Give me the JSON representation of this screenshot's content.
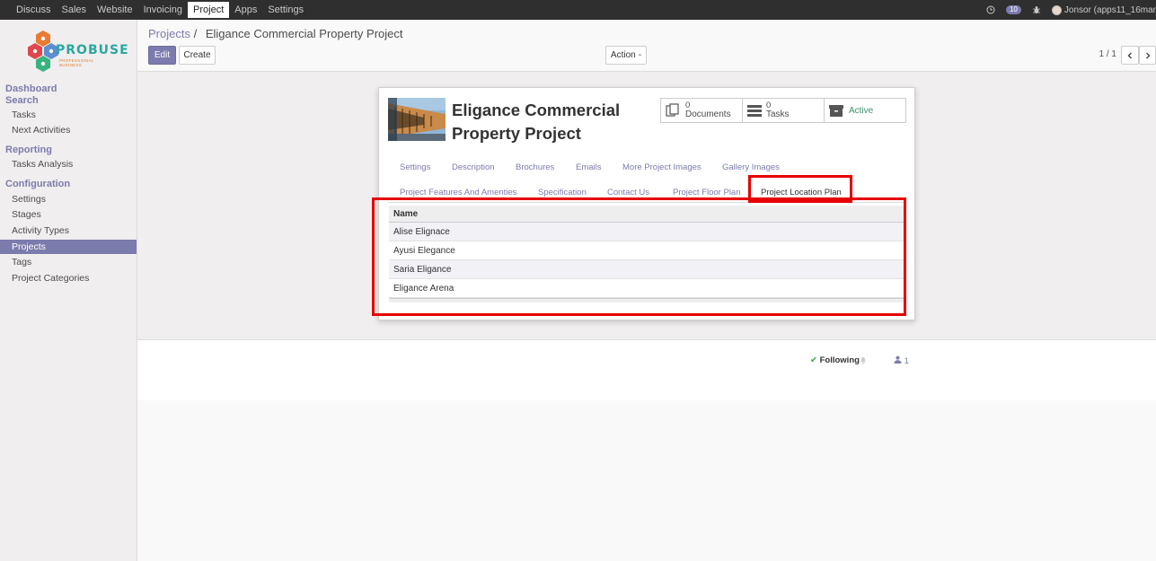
{
  "topnav": {
    "menu": [
      "Discuss",
      "Sales",
      "Website",
      "Invoicing",
      "Project",
      "Apps",
      "Settings"
    ],
    "active": "Project",
    "badge_count": "10",
    "user": "Jonsor (apps11_16mar"
  },
  "logo": {
    "name": "PROBUSE",
    "tagline": "PROFESSIONAL BUSINESS"
  },
  "sidebar": {
    "dashboard": "Dashboard",
    "search": "Search",
    "tasks": "Tasks",
    "next_activities": "Next Activities",
    "reporting": "Reporting",
    "tasks_analysis": "Tasks Analysis",
    "configuration": "Configuration",
    "settings": "Settings",
    "stages": "Stages",
    "activity_types": "Activity Types",
    "projects": "Projects",
    "tags": "Tags",
    "project_categories": "Project Categories"
  },
  "breadcrumb": {
    "parent": "Projects",
    "sep": "/",
    "current": "Eligance Commercial Property Project"
  },
  "buttons": {
    "edit": "Edit",
    "create": "Create",
    "action": "Action"
  },
  "pager": {
    "value": "1 / 1"
  },
  "record": {
    "title_line1": "Eligance Commercial",
    "title_line2": "Property Project",
    "stats": {
      "documents_count": "0",
      "documents_label": "Documents",
      "tasks_count": "0",
      "tasks_label": "Tasks",
      "active_label": "Active"
    }
  },
  "tabs": {
    "row1": [
      "Settings",
      "Description",
      "Brochures",
      "Emails",
      "More Project Images",
      "Gallery Images"
    ],
    "row2": [
      "Project Features And Amenties",
      "Specification",
      "Contact Us",
      "Project Floor Plan",
      "Project Location Plan"
    ],
    "active": "Project Location Plan"
  },
  "table": {
    "header": "Name",
    "rows": [
      "Alise Elignace",
      "Ayusi Elegance",
      "Saria Eligance",
      "Eligance Arena"
    ]
  },
  "chatter": {
    "following": "Following",
    "followers": "1"
  },
  "colors": {
    "brand": "#7c7bad",
    "highlight": "#e60000",
    "navbar": "#2f2f2f"
  }
}
